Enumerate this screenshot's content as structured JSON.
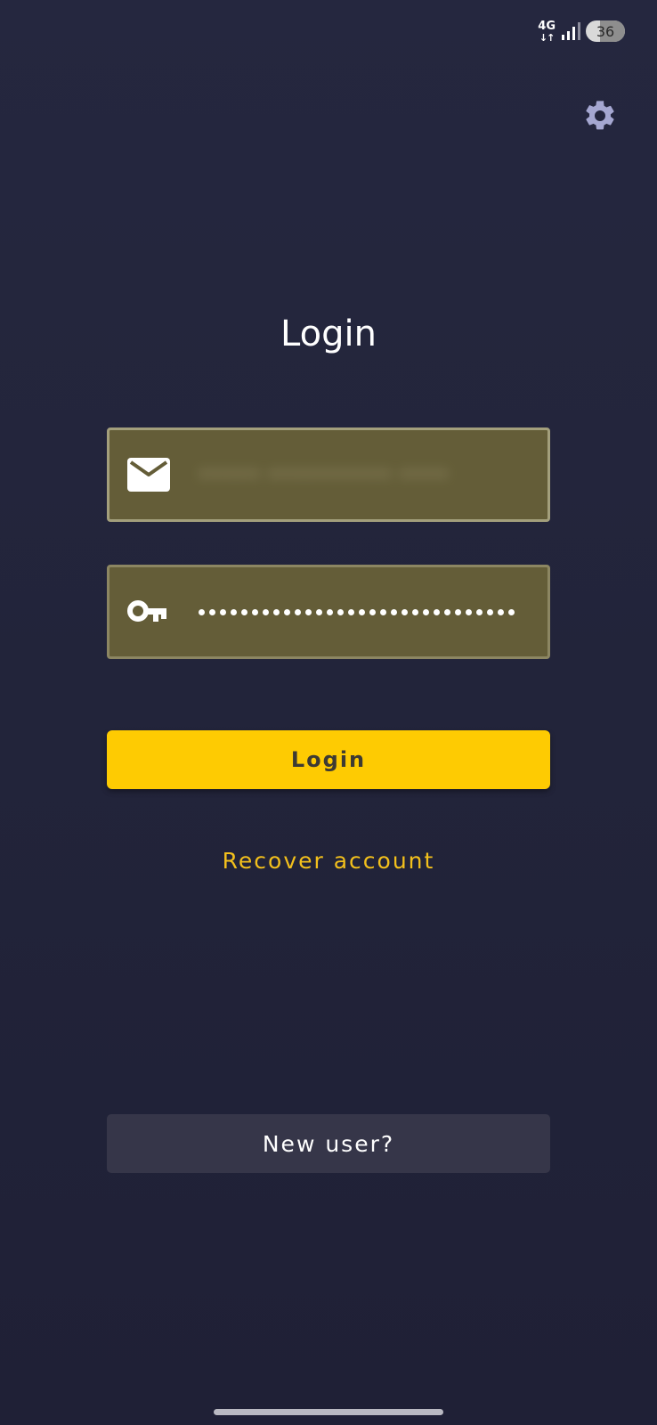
{
  "status_bar": {
    "network_type": "4G",
    "network_arrows": "↓↑",
    "battery_level": "36",
    "battery_percent": 36,
    "icons": [
      "signal-icon",
      "battery-icon"
    ]
  },
  "header": {
    "settings_icon": "gear-icon"
  },
  "login_form": {
    "title": "Login",
    "email": {
      "icon": "mail-icon",
      "value": "••••• •••••••••• ••••",
      "blurred": true
    },
    "password": {
      "icon": "key-icon",
      "masked_length": 30
    },
    "login_label": "Login",
    "recover_label": "Recover account",
    "new_user_label": "New user?"
  },
  "colors": {
    "background": "#23253d",
    "field_fill": "#645d38",
    "field_border": "#938f6d",
    "primary_button": "#fecb02",
    "link": "#f3c01c",
    "secondary_button": "#363649",
    "settings_icon": "#a5a7d1"
  }
}
